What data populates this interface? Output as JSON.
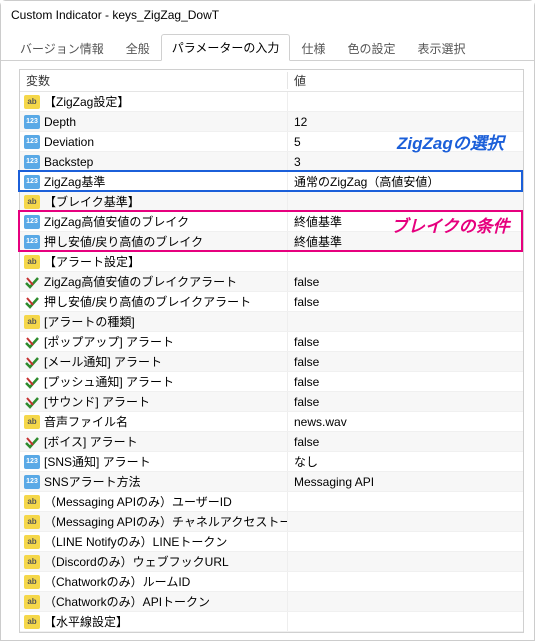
{
  "window": {
    "title": "Custom Indicator - keys_ZigZag_DowT"
  },
  "tabs": [
    {
      "id": "versionInfo",
      "label": "バージョン情報",
      "active": false
    },
    {
      "id": "general",
      "label": "全般",
      "active": false
    },
    {
      "id": "params",
      "label": "パラメーターの入力",
      "active": true
    },
    {
      "id": "spec",
      "label": "仕様",
      "active": false
    },
    {
      "id": "colors",
      "label": "色の設定",
      "active": false
    },
    {
      "id": "display",
      "label": "表示選択",
      "active": false
    }
  ],
  "columns": {
    "name": "変数",
    "value": "値"
  },
  "rows": [
    {
      "type": "ab",
      "name": "【ZigZag設定】",
      "value": ""
    },
    {
      "type": "123",
      "name": "Depth",
      "value": "12"
    },
    {
      "type": "123",
      "name": "Deviation",
      "value": "5"
    },
    {
      "type": "123",
      "name": "Backstep",
      "value": "3"
    },
    {
      "type": "123",
      "name": "ZigZag基準",
      "value": "通常のZigZag（高値安値）"
    },
    {
      "type": "ab",
      "name": "【ブレイク基準】",
      "value": ""
    },
    {
      "type": "123",
      "name": "ZigZag高値安値のブレイク",
      "value": "終値基準"
    },
    {
      "type": "123",
      "name": "押し安値/戻り高値のブレイク",
      "value": "終値基準"
    },
    {
      "type": "ab",
      "name": "【アラート設定】",
      "value": ""
    },
    {
      "type": "bool",
      "name": "ZigZag高値安値のブレイクアラート",
      "value": "false"
    },
    {
      "type": "bool",
      "name": "押し安値/戻り高値のブレイクアラート",
      "value": "false"
    },
    {
      "type": "ab",
      "name": "[アラートの種類]",
      "value": ""
    },
    {
      "type": "bool",
      "name": "[ポップアップ] アラート",
      "value": "false"
    },
    {
      "type": "bool",
      "name": "[メール通知] アラート",
      "value": "false"
    },
    {
      "type": "bool",
      "name": "[プッシュ通知] アラート",
      "value": "false"
    },
    {
      "type": "bool",
      "name": "[サウンド] アラート",
      "value": "false"
    },
    {
      "type": "ab",
      "name": "音声ファイル名",
      "value": "news.wav"
    },
    {
      "type": "bool",
      "name": "[ボイス] アラート",
      "value": "false"
    },
    {
      "type": "123",
      "name": "[SNS通知] アラート",
      "value": "なし"
    },
    {
      "type": "123",
      "name": "SNSアラート方法",
      "value": "Messaging API"
    },
    {
      "type": "ab",
      "name": "（Messaging APIのみ）ユーザーID",
      "value": ""
    },
    {
      "type": "ab",
      "name": "（Messaging APIのみ）チャネルアクセストークン",
      "value": ""
    },
    {
      "type": "ab",
      "name": "（LINE Notifyのみ）LINEトークン",
      "value": ""
    },
    {
      "type": "ab",
      "name": "（Discordのみ）ウェブフックURL",
      "value": ""
    },
    {
      "type": "ab",
      "name": "（Chatworkのみ）ルームID",
      "value": ""
    },
    {
      "type": "ab",
      "name": "（Chatworkのみ）APIトークン",
      "value": ""
    },
    {
      "type": "ab",
      "name": "【水平線設定】",
      "value": ""
    }
  ],
  "annotations": {
    "zigzag_select": "ZigZagの選択",
    "break_cond": "ブレイクの条件"
  }
}
